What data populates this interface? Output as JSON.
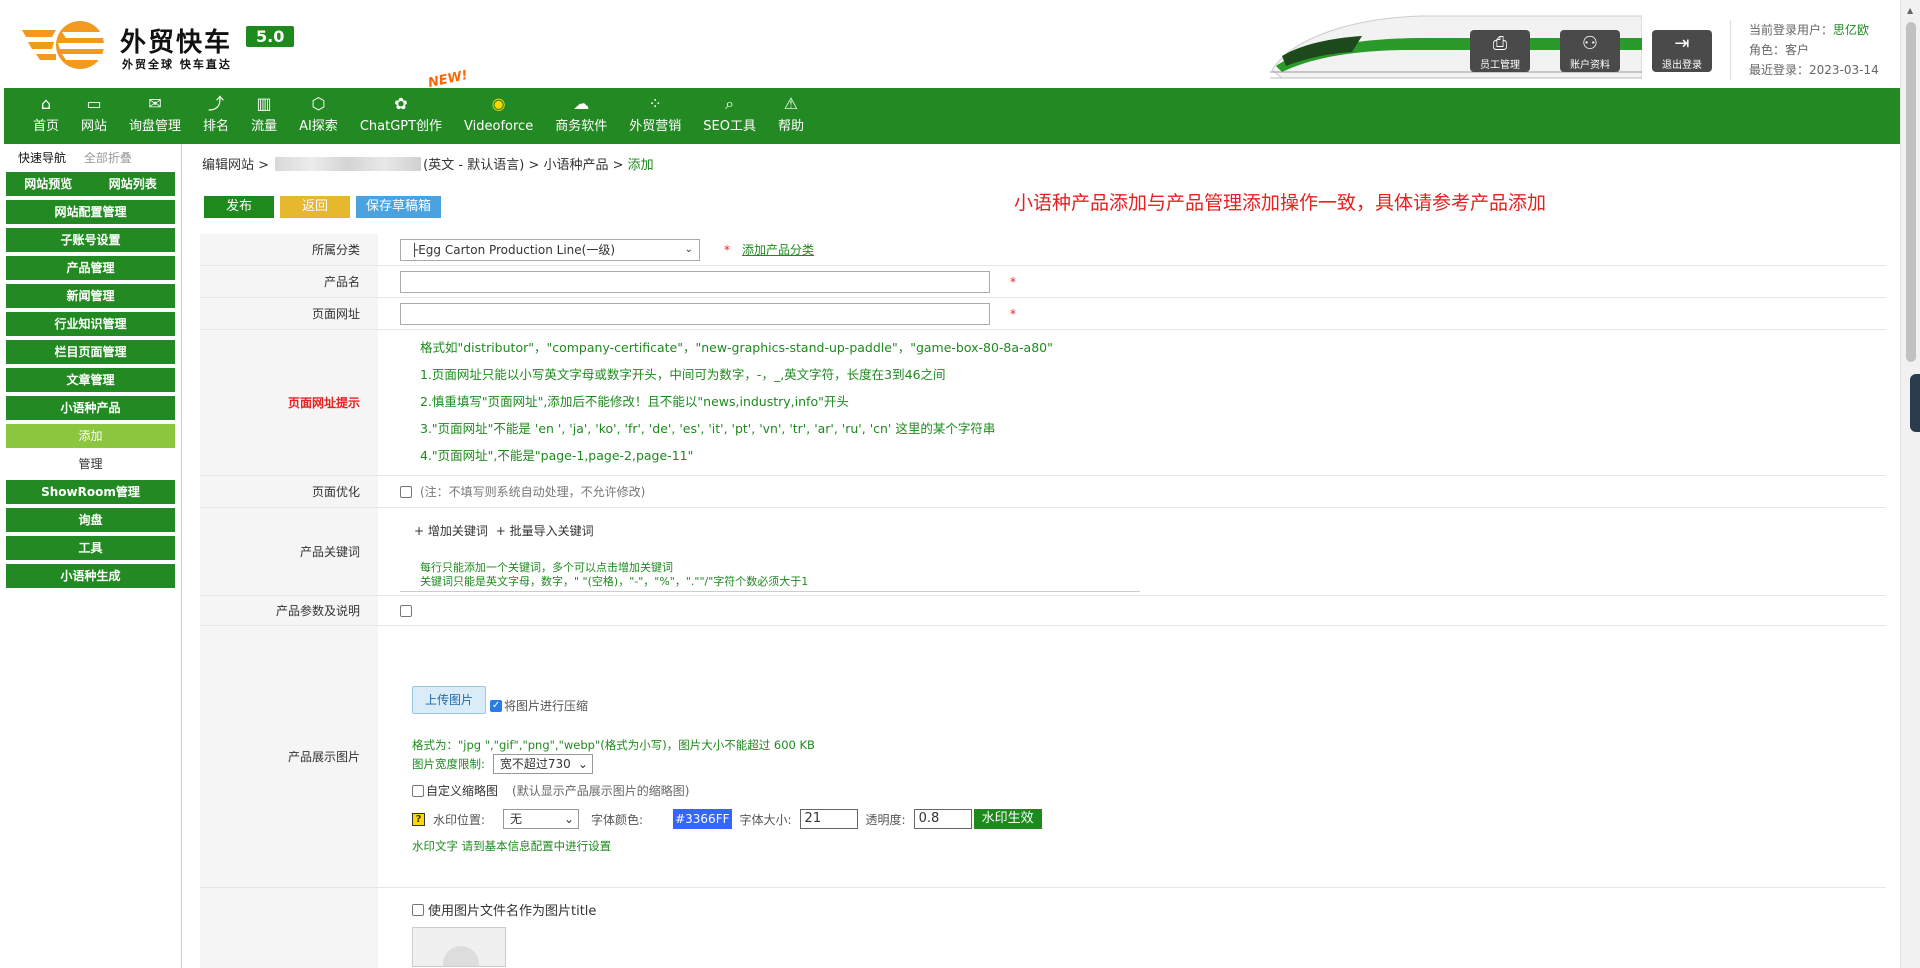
{
  "header": {
    "logo_title": "外贸快车",
    "logo_sub": "外贸全球 快车直达",
    "version": "5.0",
    "buttons": [
      {
        "label": "员工管理",
        "icon": "staff-icon"
      },
      {
        "label": "账户资料",
        "icon": "account-icon"
      },
      {
        "label": "退出登录",
        "icon": "logout-icon"
      }
    ],
    "user_label": "当前登录用户：",
    "user_name": "思亿欧",
    "role": "角色：客户",
    "last_login": "最近登录：2023-03-14"
  },
  "nav": {
    "items": [
      {
        "label": "首页",
        "icon": "home-icon"
      },
      {
        "label": "网站",
        "icon": "monitor-icon"
      },
      {
        "label": "询盘管理",
        "icon": "mail-icon"
      },
      {
        "label": "排名",
        "icon": "ranking-icon"
      },
      {
        "label": "流量",
        "icon": "traffic-icon"
      },
      {
        "label": "AI探索",
        "icon": "ai-icon"
      },
      {
        "label": "ChatGPT创作",
        "icon": "chatgpt-icon"
      },
      {
        "label": "Videoforce",
        "icon": "video-icon"
      },
      {
        "label": "商务软件",
        "icon": "software-icon"
      },
      {
        "label": "外贸营销",
        "icon": "marketing-icon"
      },
      {
        "label": "SEO工具",
        "icon": "search-icon"
      },
      {
        "label": "帮助",
        "icon": "help-icon"
      }
    ],
    "new_badge": "NEW!"
  },
  "sidebar": {
    "quick_nav": "快速导航",
    "collapse_all": "全部折叠",
    "top_pair": [
      "网站预览",
      "网站列表"
    ],
    "items": [
      {
        "label": "网站配置管理",
        "type": "main"
      },
      {
        "label": "子账号设置",
        "type": "main"
      },
      {
        "label": "产品管理",
        "type": "main"
      },
      {
        "label": "新闻管理",
        "type": "main"
      },
      {
        "label": "行业知识管理",
        "type": "main"
      },
      {
        "label": "栏目页面管理",
        "type": "main"
      },
      {
        "label": "文章管理",
        "type": "main"
      },
      {
        "label": "小语种产品",
        "type": "main"
      },
      {
        "label": "添加",
        "type": "sub-active"
      },
      {
        "label": "管理",
        "type": "sub"
      },
      {
        "label": "ShowRoom管理",
        "type": "main"
      },
      {
        "label": "询盘",
        "type": "main"
      },
      {
        "label": "工具",
        "type": "main"
      },
      {
        "label": "小语种生成",
        "type": "main"
      }
    ]
  },
  "breadcrumb": {
    "edit_site": "编辑网站 >",
    "site_suffix": "(英文 - 默认语言) >",
    "section": "小语种产品 >",
    "current": "添加"
  },
  "toolbar": {
    "publish": "发布",
    "back": "返回",
    "save_draft": "保存草稿箱"
  },
  "notice": "小语种产品添加与产品管理添加操作一致，具体请参考产品添加",
  "form": {
    "category_label": "所属分类",
    "category_value": "├Egg Carton Production Line(一级)",
    "required_mark": "*",
    "add_category_link": "添加产品分类",
    "name_label": "产品名",
    "url_label": "页面网址",
    "url_hint_label": "页面网址提示",
    "url_hints": [
      "格式如\"distributor\"，\"company-certificate\"，\"new-graphics-stand-up-paddle\"，\"game-box-80-8a-a80\"",
      "1.页面网址只能以小写英文字母或数字开头，中间可为数字，-，_,英文字符，长度在3到46之间",
      "2.慎重填写\"页面网址\",添加后不能修改！且不能以\"news,industry,info\"开头",
      "3.\"页面网址\"不能是 'en ', 'ja', 'ko', 'fr', 'de', 'es', 'it', 'pt', 'vn', 'tr', 'ar', 'ru', 'cn' 这里的某个字符串",
      "4.\"页面网址\",不能是\"page-1,page-2,page-11\""
    ],
    "seo_label": "页面优化",
    "seo_note": "(注：不填写则系统自动处理，不允许修改)",
    "keywords_label": "产品关键词",
    "add_keyword": "+ 增加关键词",
    "batch_import": "+ 批量导入关键词",
    "keyword_hint1": "每行只能添加一个关键词，多个可以点击增加关键词",
    "keyword_hint2": "关键词只能是英文字母，数字，\" \"(空格)，\"-\"，\"%\"，\".\"\"/\"字符个数必须大于1",
    "params_label": "产品参数及说明",
    "images_label": "产品展示图片",
    "upload_btn": "上传图片",
    "compress_label": "将图片进行压缩",
    "format_hint": "格式为：\"jpg \",\"gif\",\"png\",\"webp\"(格式为小写)，图片大小不能超过 600 KB",
    "width_label": "图片宽度限制:",
    "width_value": "宽不超过730",
    "thumb_label": "自定义缩略图",
    "thumb_note": "(默认显示产品展示图片的缩略图)",
    "wm_pos_label": "水印位置:",
    "wm_pos_value": "无",
    "font_color_label": "字体颜色:",
    "font_color_value": "#3366FF",
    "font_size_label": "字体大小:",
    "font_size_value": "21",
    "opacity_label": "透明度:",
    "opacity_value": "0.8",
    "wm_apply": "水印生效",
    "wm_text_hint": "水印文字 请到基本信息配置中进行设置",
    "filename_title_label": "使用图片文件名作为图片title"
  }
}
